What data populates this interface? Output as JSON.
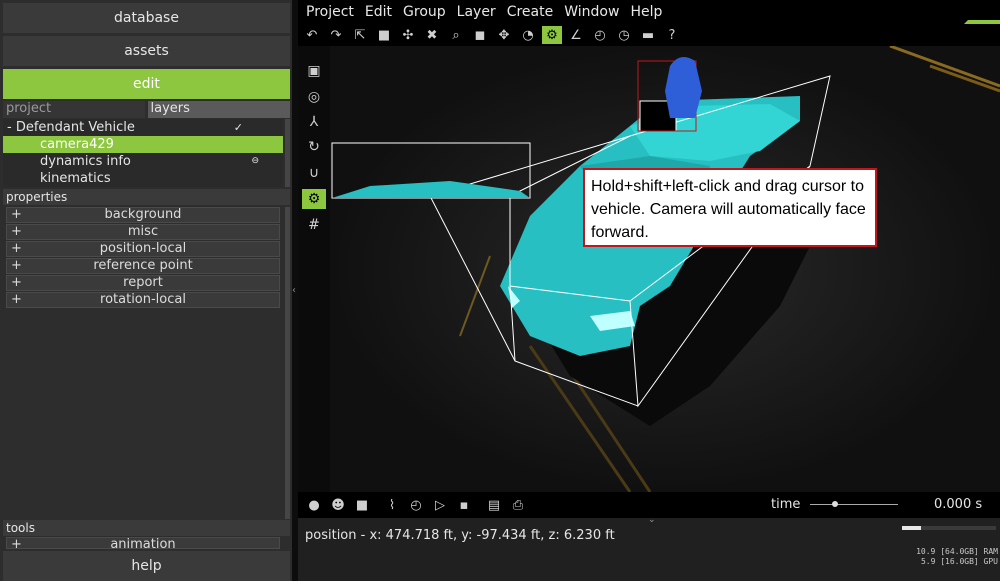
{
  "left_panel": {
    "nav": {
      "database": "database",
      "assets": "assets",
      "edit": "edit",
      "help": "help"
    },
    "tabs": {
      "project": "project",
      "layers": "layers"
    },
    "tree": {
      "root": "-  Defendant Vehicle",
      "items": [
        "camera429",
        "dynamics info",
        "kinematics"
      ],
      "selected": "camera429"
    },
    "properties": {
      "header": "properties",
      "items": [
        "background",
        "misc",
        "position-local",
        "reference point",
        "report",
        "rotation-local"
      ]
    },
    "tools": {
      "header": "tools",
      "items": [
        "animation"
      ]
    }
  },
  "menu": {
    "items": [
      "Project",
      "Edit",
      "Group",
      "Layer",
      "Create",
      "Window",
      "Help"
    ]
  },
  "toolbar": {
    "icons": [
      "undo-icon",
      "redo-icon",
      "select-icon",
      "square-icon",
      "snap-icon",
      "delete-icon",
      "magnify-icon",
      "cube-icon",
      "move-icon",
      "measure-icon",
      "camera-group-icon",
      "angle-icon",
      "gauge-icon",
      "ruler-icon",
      "help-icon"
    ],
    "active": "camera-group-icon"
  },
  "callout": {
    "text": "Hold+shift+left-click and drag cursor to vehicle. Camera will automatically face forward."
  },
  "timeline": {
    "label": "time",
    "value": "0.000 s"
  },
  "status": {
    "position": "position - x: 474.718 ft, y: -97.434 ft, z: 6.230 ft",
    "ram": "10.9 [64.0GB] RAM",
    "gpu": "5.9 [16.0GB] GPU",
    "progress": 0.2
  },
  "colors": {
    "accent": "#8dc63f",
    "vehicle": "#2ec4c4",
    "callout_border": "#c0171c"
  }
}
